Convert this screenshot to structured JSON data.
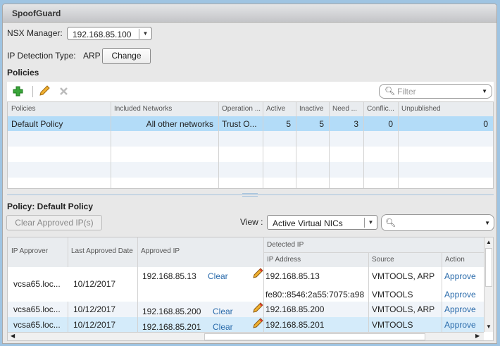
{
  "title": "SpoofGuard",
  "nsx_manager": {
    "label": "NSX Manager:",
    "value": "192.168.85.100"
  },
  "ip_detection": {
    "label": "IP Detection Type:",
    "value": "ARP",
    "button": "Change"
  },
  "policies": {
    "heading": "Policies",
    "toolbar": {
      "add": "add-icon",
      "edit": "pencil-icon",
      "delete": "delete-icon",
      "filter_placeholder": "Filter"
    },
    "columns": [
      "Policies",
      "Included Networks",
      "Operation ...",
      "Active",
      "Inactive",
      "Need ...",
      "Conflic...",
      "Unpublished"
    ],
    "rows": [
      {
        "name": "Default Policy",
        "networks": "All other networks",
        "operation": "Trust O...",
        "active": "5",
        "inactive": "5",
        "need": "3",
        "conflict": "0",
        "unpublished": "0"
      }
    ]
  },
  "policy_detail": {
    "heading": "Policy: Default Policy",
    "clear_button": "Clear Approved IP(s)",
    "view_label": "View :",
    "view_value": "Active Virtual NICs",
    "columns": {
      "approver": "IP Approver",
      "date": "Last Approved Date",
      "approved_ip": "Approved IP",
      "detected_group": "Detected IP",
      "ip_address": "IP Address",
      "source": "Source",
      "action": "Action"
    },
    "rows": [
      {
        "approver": "vcsa65.loc...",
        "date": "10/12/2017",
        "approved_ip": "192.168.85.13",
        "clear": "Clear",
        "detected": [
          {
            "ip": "192.168.85.13",
            "source": "VMTOOLS, ARP",
            "action": "Approve"
          },
          {
            "ip": "fe80::8546:2a55:7075:a98",
            "source": "VMTOOLS",
            "action": "Approve"
          }
        ]
      },
      {
        "approver": "vcsa65.loc...",
        "date": "10/12/2017",
        "approved_ip": "192.168.85.200",
        "clear": "Clear",
        "detected": [
          {
            "ip": "192.168.85.200",
            "source": "VMTOOLS, ARP",
            "action": "Approve"
          }
        ]
      },
      {
        "approver": "vcsa65.loc...",
        "date": "10/12/2017",
        "approved_ip": "192.168.85.201",
        "clear": "Clear",
        "detected": [
          {
            "ip": "192.168.85.201",
            "source": "VMTOOLS",
            "action": "Approve"
          }
        ]
      }
    ]
  },
  "colors": {
    "selected_row": "#b3dcf8",
    "selected_row_light": "#d4ebfa",
    "alt_row": "#f0f4f9",
    "link": "#2a6bab"
  }
}
